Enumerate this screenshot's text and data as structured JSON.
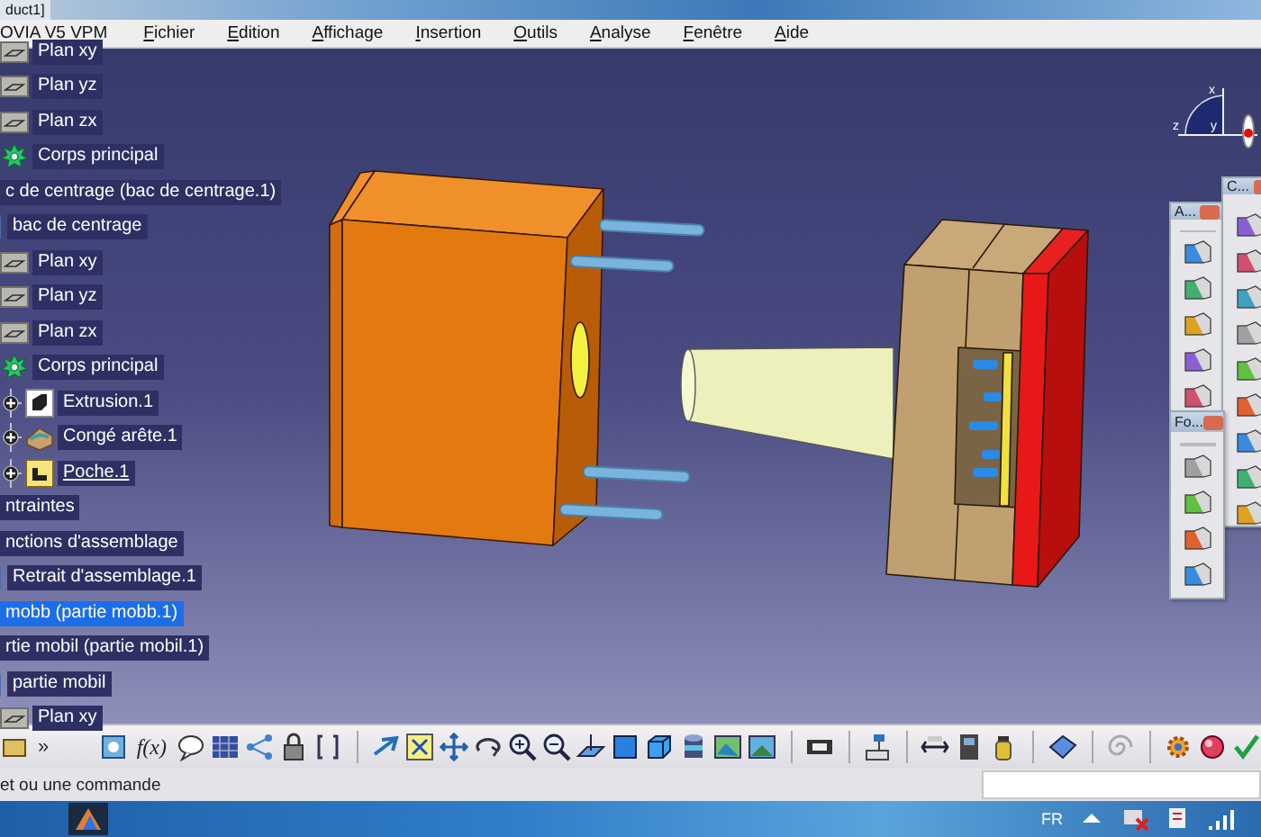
{
  "window": {
    "title": "duct1]"
  },
  "menu": {
    "app": "OVIA V5 VPM",
    "items": [
      "Fichier",
      "Edition",
      "Affichage",
      "Insertion",
      "Outils",
      "Analyse",
      "Fenêtre",
      "Aide"
    ]
  },
  "tree": {
    "clipped_branch": [
      {
        "label": "Plan xy",
        "kind": "plane",
        "selected": false
      },
      {
        "label": "Plan yz",
        "kind": "plane",
        "selected": false
      },
      {
        "label": "Plan zx",
        "kind": "plane",
        "selected": false
      },
      {
        "label": "Corps principal",
        "kind": "body",
        "selected": false
      }
    ],
    "items": [
      {
        "label": "c de centrage (bac de centrage.1)",
        "selected": false,
        "children": [
          {
            "label": "bac de centrage",
            "kind": "part",
            "selected": false,
            "children": [
              {
                "label": "Plan xy",
                "kind": "plane",
                "selected": false
              },
              {
                "label": "Plan yz",
                "kind": "plane",
                "selected": false
              },
              {
                "label": "Plan zx",
                "kind": "plane",
                "selected": false
              },
              {
                "label": "Corps principal",
                "kind": "body",
                "selected": false,
                "children": [
                  {
                    "label": "Extrusion.1",
                    "kind": "extrusion",
                    "selected": false,
                    "expanded": false,
                    "underlined": false
                  },
                  {
                    "label": "Congé arête.1",
                    "kind": "fillet",
                    "selected": false,
                    "expanded": false,
                    "underlined": false
                  },
                  {
                    "label": "Poche.1",
                    "kind": "pocket",
                    "selected": false,
                    "expanded": false,
                    "underlined": true
                  }
                ]
              }
            ]
          }
        ]
      },
      {
        "label": "ntraintes",
        "selected": false
      },
      {
        "label": "nctions d'assemblage",
        "selected": false,
        "children": [
          {
            "label": "Retrait d'assemblage.1",
            "kind": "part",
            "selected": false
          }
        ]
      },
      {
        "label": "mobb (partie mobb.1)",
        "selected": true
      },
      {
        "label": "rtie mobil (partie mobil.1)",
        "selected": false,
        "children": [
          {
            "label": "partie mobil",
            "kind": "part",
            "selected": false,
            "children": [
              {
                "label": "Plan xy",
                "kind": "plane",
                "selected": false
              }
            ]
          }
        ]
      }
    ]
  },
  "compass": {
    "x": "x",
    "y": "y",
    "z": "z"
  },
  "palettes": [
    {
      "title": "A..."
    },
    {
      "title": "C..."
    },
    {
      "title": "Fo..."
    }
  ],
  "toolbar": {
    "chevron": "»",
    "formula": "f(x)"
  },
  "status": {
    "prompt": "et ou une commande"
  },
  "taskbar": {
    "language": "FR"
  }
}
